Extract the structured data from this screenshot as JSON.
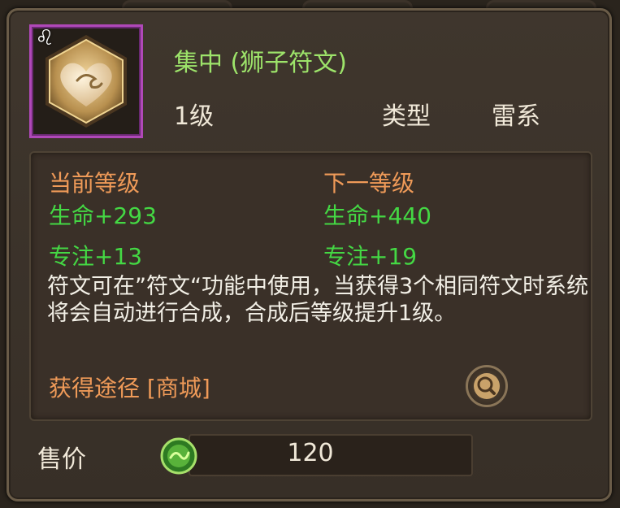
{
  "item": {
    "title": "集中 (狮子符文)",
    "level": "1级",
    "type_label": "类型",
    "type_value": "雷系",
    "zodiac_glyph": "♌",
    "icon": "rune-heart-icon",
    "rarity_color": "#b048b8"
  },
  "current": {
    "header": "当前等级",
    "stats": [
      "生命+293",
      "专注+13"
    ]
  },
  "next": {
    "header": "下一等级",
    "stats": [
      "生命+440",
      "专注+19"
    ]
  },
  "description": "符文可在”符文“功能中使用，当获得3个相同符文时系统将会自动进行合成，合成后等级提升1级。",
  "source": "获得途径 [商城]",
  "price": {
    "label": "售价",
    "value": "120",
    "currency_icon": "green-coin-icon"
  }
}
